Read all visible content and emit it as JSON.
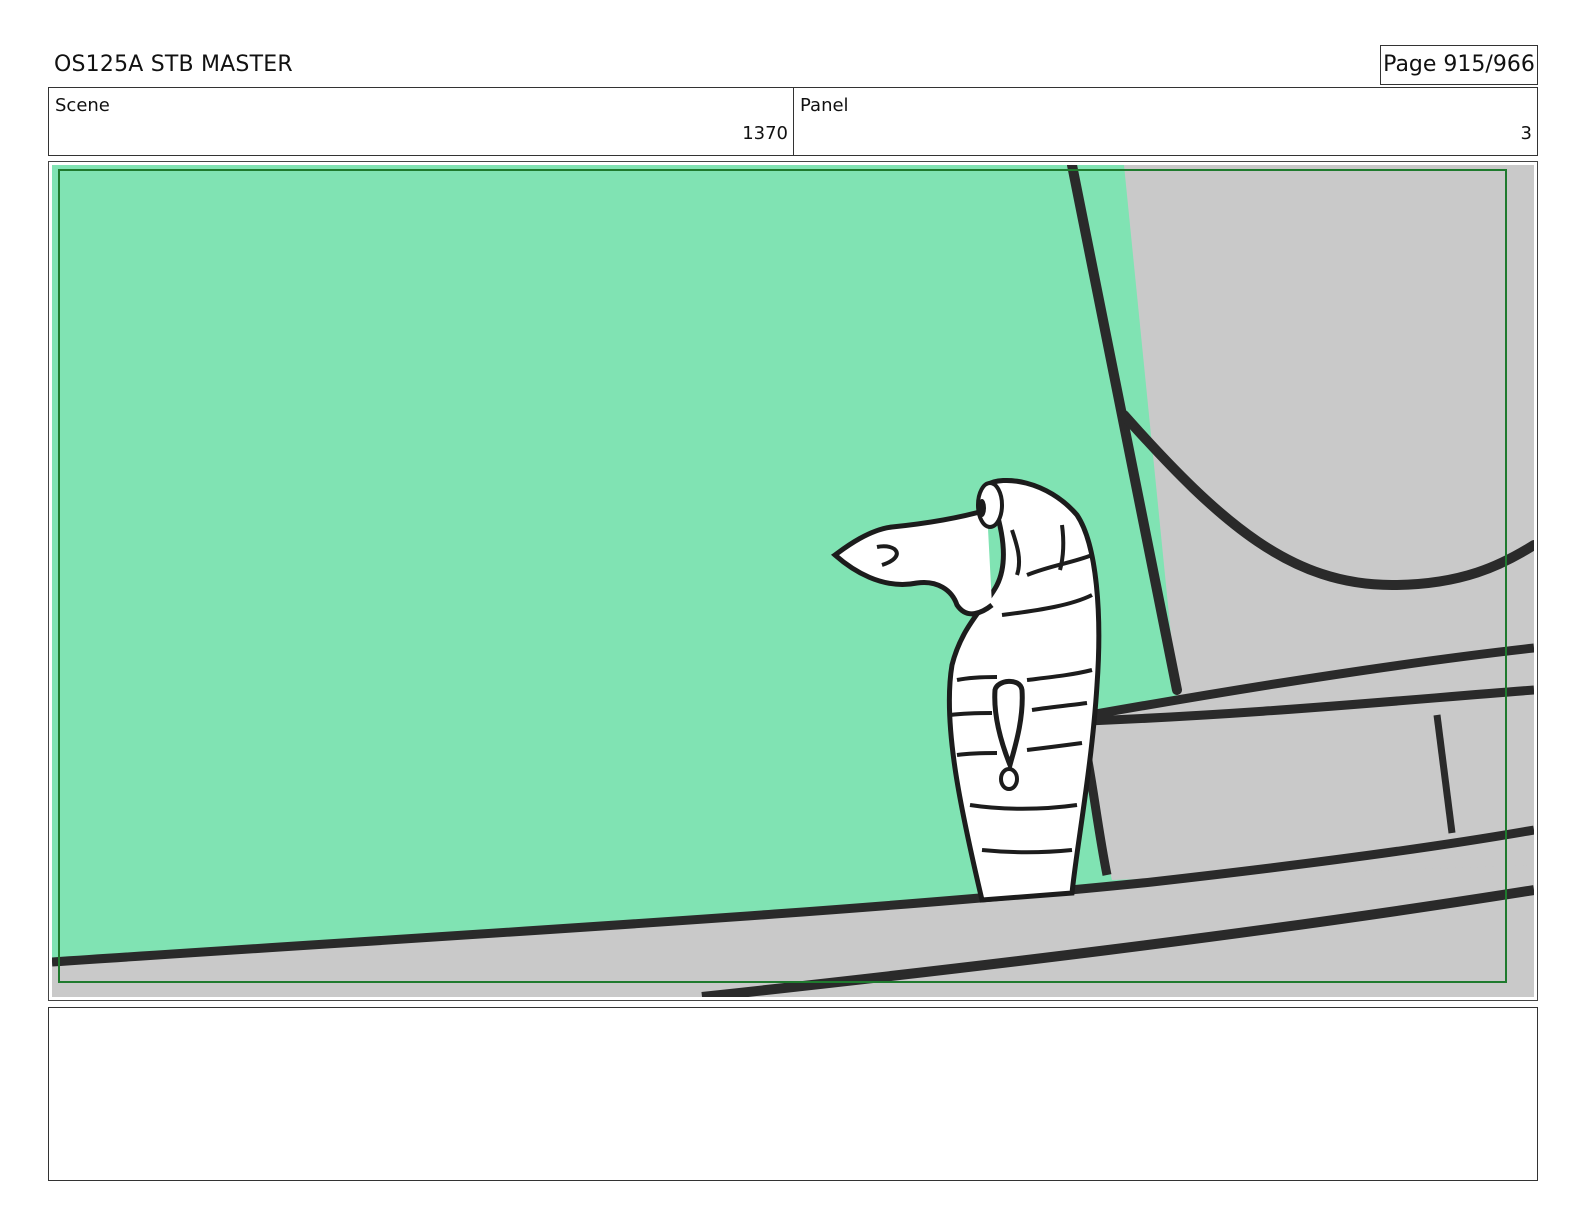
{
  "header": {
    "title": "OS125A STB MASTER",
    "page_label": "Page 915/966"
  },
  "scene": {
    "label": "Scene",
    "value": "1370"
  },
  "panel": {
    "label": "Panel",
    "value": "3"
  },
  "notes": {
    "text": ""
  },
  "colors": {
    "background_green": "#80e3b3",
    "wall_gray": "#c9c9c9",
    "ink": "#222222",
    "safe_frame": "#1f7a2e"
  }
}
